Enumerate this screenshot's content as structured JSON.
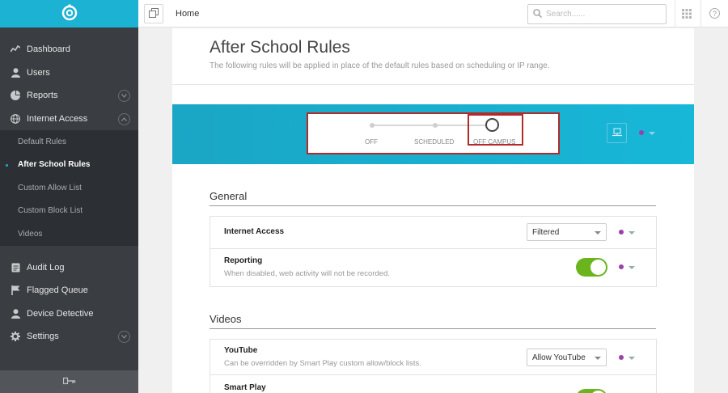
{
  "sidebar": {
    "items": [
      {
        "label": "Dashboard",
        "icon": "chart-line-icon"
      },
      {
        "label": "Users",
        "icon": "user-icon"
      },
      {
        "label": "Reports",
        "icon": "pie-chart-icon"
      },
      {
        "label": "Internet Access",
        "icon": "globe-icon"
      }
    ],
    "sub_items": [
      {
        "label": "Default Rules"
      },
      {
        "label": "After School Rules",
        "active": true
      },
      {
        "label": "Custom Allow List"
      },
      {
        "label": "Custom Block List"
      },
      {
        "label": "Videos"
      }
    ],
    "items2": [
      {
        "label": "Audit Log",
        "icon": "log-icon"
      },
      {
        "label": "Flagged Queue",
        "icon": "flag-icon"
      },
      {
        "label": "Device Detective",
        "icon": "detective-icon"
      },
      {
        "label": "Settings",
        "icon": "gear-icon"
      }
    ]
  },
  "topbar": {
    "breadcrumb": "Home",
    "search_placeholder": "Search......"
  },
  "page": {
    "title": "After School Rules",
    "subtitle": "The following rules will be applied in place of the default rules based on scheduling or IP range."
  },
  "state_selector": {
    "options": [
      "OFF",
      "SCHEDULED",
      "OFF CAMPUS"
    ],
    "selected": "OFF CAMPUS"
  },
  "sections": {
    "general": {
      "title": "General",
      "internet_access": {
        "label": "Internet Access",
        "value": "Filtered"
      },
      "reporting": {
        "label": "Reporting",
        "description": "When disabled, web activity will not be recorded.",
        "enabled": true
      }
    },
    "videos": {
      "title": "Videos",
      "youtube": {
        "label": "YouTube",
        "description": "Can be overridden by Smart Play custom allow/block lists.",
        "value": "Allow YouTube"
      },
      "smart_play": {
        "label": "Smart Play"
      }
    }
  },
  "colors": {
    "brand": "#1bb2d3",
    "sidebar": "#3a3d42",
    "toggle_on": "#6ab41e",
    "highlight": "#b32a2a",
    "status_dot": "#9b3fb0"
  }
}
